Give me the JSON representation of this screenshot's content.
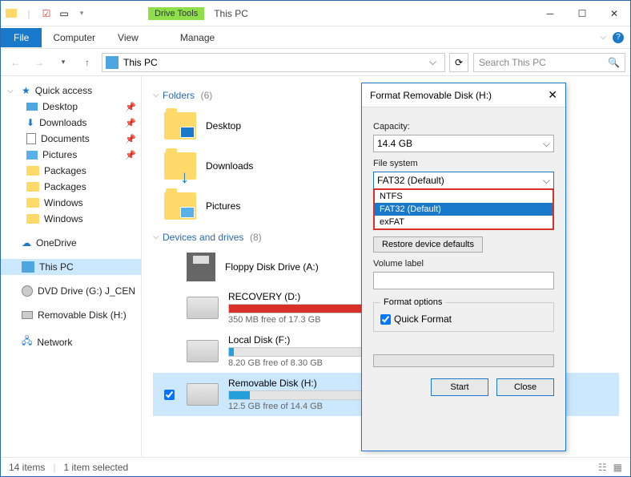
{
  "titlebar": {
    "title": "This PC",
    "drive_tools": "Drive Tools"
  },
  "ribbon": {
    "file": "File",
    "computer": "Computer",
    "view": "View",
    "manage": "Manage"
  },
  "address": {
    "location": "This PC",
    "search_placeholder": "Search This PC"
  },
  "sidebar": {
    "quick_access": "Quick access",
    "items": [
      {
        "label": "Desktop",
        "pinned": true
      },
      {
        "label": "Downloads",
        "pinned": true
      },
      {
        "label": "Documents",
        "pinned": true
      },
      {
        "label": "Pictures",
        "pinned": true
      },
      {
        "label": "Packages"
      },
      {
        "label": "Packages"
      },
      {
        "label": "Windows"
      },
      {
        "label": "Windows"
      }
    ],
    "onedrive": "OneDrive",
    "this_pc": "This PC",
    "dvd": "DVD Drive (G:) J_CEN",
    "removable": "Removable Disk (H:)",
    "network": "Network"
  },
  "content": {
    "folders_header": "Folders",
    "folders_count": "(6)",
    "folders": [
      "Desktop",
      "Downloads",
      "Pictures"
    ],
    "devices_header": "Devices and drives",
    "devices_count": "(8)",
    "floppy": "Floppy Disk Drive (A:)",
    "drives": [
      {
        "name": "RECOVERY (D:)",
        "free": "350 MB free of 17.3 GB",
        "fill": 98,
        "red": true
      },
      {
        "name": "Local Disk (F:)",
        "free": "8.20 GB free of 8.30 GB",
        "fill": 3
      },
      {
        "name": "Removable Disk (H:)",
        "free": "12.5 GB free of 14.4 GB",
        "fill": 14,
        "selected": true
      }
    ]
  },
  "status": {
    "items": "14 items",
    "selected": "1 item selected"
  },
  "dialog": {
    "title": "Format Removable Disk (H:)",
    "capacity_label": "Capacity:",
    "capacity_value": "14.4 GB",
    "fs_label": "File system",
    "fs_value": "FAT32 (Default)",
    "fs_options": [
      "NTFS",
      "FAT32 (Default)",
      "exFAT"
    ],
    "restore": "Restore device defaults",
    "volume_label": "Volume label",
    "volume_value": "",
    "format_options": "Format options",
    "quick_format": "Quick Format",
    "start": "Start",
    "close": "Close"
  }
}
